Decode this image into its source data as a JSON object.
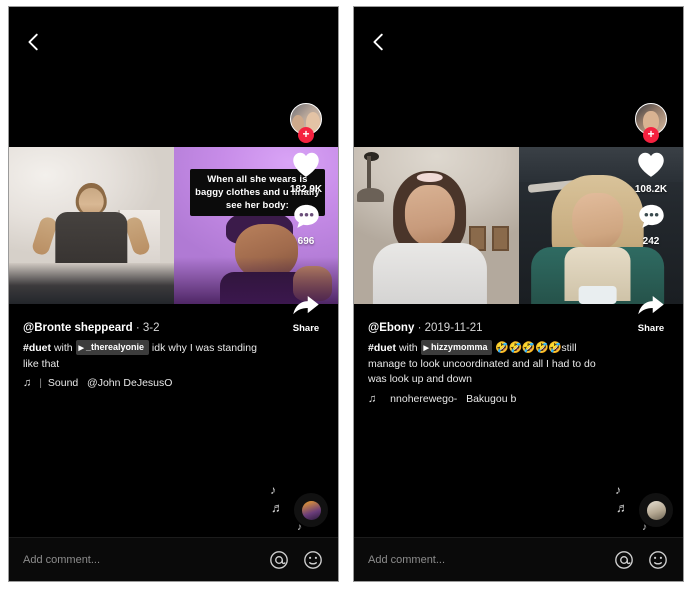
{
  "app": {
    "name": "TikTok duet video player",
    "panel_count": 2
  },
  "panels": [
    {
      "id": "left",
      "back_icon": "chevron-left-icon",
      "video": {
        "layout": "duet-side-by-side",
        "left_clip": "girl standing in white bedroom wearing oversized dark t-shirt",
        "right_clip": "young man in purple lighting reacting to camera",
        "overlay_text": "When all she wears is baggy clothes and u finally see her body:"
      },
      "actions": {
        "avatar": "creator-avatar",
        "follow_label": "+",
        "like_icon": "heart-icon",
        "like_count": "182.9K",
        "comment_icon": "comment-bubble-icon",
        "comment_count": "696",
        "share_icon": "share-arrow-icon",
        "share_label": "Share"
      },
      "info": {
        "author": "@Bronte sheppeard",
        "date_separator": "·",
        "date": "3-2",
        "caption_tag": "#duet",
        "caption_with": "with",
        "caption_chip": "_therealyonie",
        "caption_chip_icon": "play-icon",
        "caption_emoji": "",
        "caption_rest": "idk why I was standing like that",
        "sound_icon": "music-note-icon",
        "sound_separator": "|",
        "sound_label": "Sound",
        "sound_author": "@John DeJesusO"
      },
      "disc": {
        "icon": "vinyl-record-icon",
        "notes": [
          "♪",
          "♬",
          "♪"
        ]
      },
      "comment_bar": {
        "placeholder": "Add comment...",
        "mention_icon": "at-icon",
        "emoji_icon": "emoji-smiley-icon"
      }
    },
    {
      "id": "right",
      "back_icon": "chevron-left-icon",
      "video": {
        "layout": "duet-side-by-side",
        "left_clip": "brunette woman with pink scrunchie in white tee indoors",
        "right_clip": "blonde woman in teal jacket inside a car",
        "overlay_text": ""
      },
      "actions": {
        "avatar": "creator-avatar",
        "follow_label": "+",
        "like_icon": "heart-icon",
        "like_count": "108.2K",
        "comment_icon": "comment-bubble-icon",
        "comment_count": "242",
        "share_icon": "share-arrow-icon",
        "share_label": "Share"
      },
      "info": {
        "author": "@Ebony",
        "date_separator": "·",
        "date": "2019-11-21",
        "caption_tag": "#duet",
        "caption_with": "with",
        "caption_chip": "hizzymomma",
        "caption_chip_icon": "play-icon",
        "caption_emoji": "🤣🤣🤣🤣🤣",
        "caption_rest": "still manage to look uncoordinated and all I had to do was look up and down",
        "sound_icon": "music-note-icon",
        "sound_separator": "",
        "sound_label": "nnoherewego-",
        "sound_author": "Bakugou b"
      },
      "disc": {
        "icon": "vinyl-record-icon",
        "notes": [
          "♪",
          "♬",
          "♪"
        ]
      },
      "comment_bar": {
        "placeholder": "Add comment...",
        "mention_icon": "at-icon",
        "emoji_icon": "emoji-smiley-icon"
      }
    }
  ],
  "colors": {
    "background": "#000000",
    "accent_red": "#f5213f",
    "text_primary": "#ffffff",
    "text_secondary": "#8c8c8c",
    "chip_bg": "#3c3c3c"
  }
}
